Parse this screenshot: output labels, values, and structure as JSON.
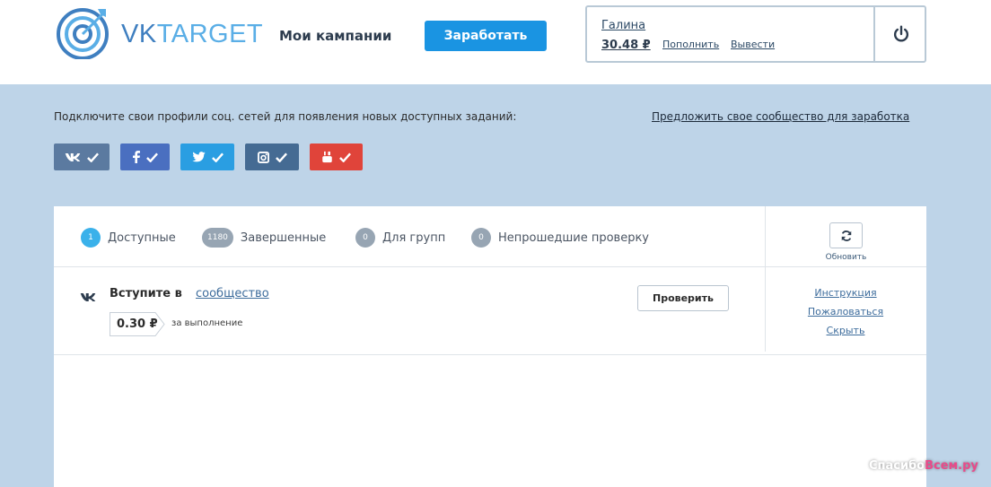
{
  "header": {
    "logo_text_vk": "VK",
    "logo_text_target": "TARGET",
    "nav_campaigns": "Мои кампании",
    "earn_button": "Заработать",
    "user": {
      "name": "Галина",
      "balance": "30.48 ₽",
      "topup": "Пополнить",
      "withdraw": "Вывести"
    },
    "power_icon": "power-icon"
  },
  "social": {
    "prompt": "Подключите свои профили соц. сетей для появления новых доступных заданий:",
    "suggest_link": "Предложить свое сообщество для заработка",
    "networks": [
      {
        "name": "vk",
        "icon": "vk-icon",
        "color": "#5b7aa0"
      },
      {
        "name": "facebook",
        "icon": "facebook-icon",
        "color": "#4a6fc0"
      },
      {
        "name": "twitter",
        "icon": "twitter-icon",
        "color": "#2a9ee2"
      },
      {
        "name": "instagram",
        "icon": "instagram-icon",
        "color": "#456b93"
      },
      {
        "name": "youtube",
        "icon": "youtube-icon",
        "color": "#e0443a"
      }
    ]
  },
  "tabs": [
    {
      "count": "1",
      "label": "Доступные",
      "active": true
    },
    {
      "count": "1180",
      "label": "Завершенные",
      "active": false
    },
    {
      "count": "0",
      "label": "Для групп",
      "active": false
    },
    {
      "count": "0",
      "label": "Непрошедшие проверку",
      "active": false
    }
  ],
  "refresh_label": "Обновить",
  "task": {
    "title": "Вступите в",
    "link": "сообщество",
    "price": "0.30 ₽",
    "price_caption": "за выполнение",
    "check_button": "Проверить",
    "actions": {
      "instruction": "Инструкция",
      "complain": "Пожаловаться",
      "hide": "Скрыть"
    }
  },
  "watermark": {
    "part1": "Спасибо",
    "part2": "Всем.ру"
  },
  "colors": {
    "accent": "#1a94e2",
    "page_bg": "#bed4e8",
    "active_badge": "#3ab1ea",
    "badge": "#97a5b3"
  }
}
